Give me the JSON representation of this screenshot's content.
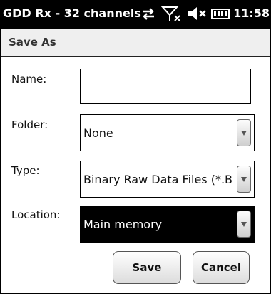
{
  "statusbar": {
    "title": "GDD Rx - 32 channels",
    "clock": "11:58",
    "icons": [
      "sync-arrows-icon",
      "no-signal-icon",
      "speaker-muted-icon",
      "battery-icon"
    ]
  },
  "dialog": {
    "title": "Save As"
  },
  "form": {
    "name_label": "Name:",
    "name_value": "",
    "folder_label": "Folder:",
    "folder_value": "None",
    "type_label": "Type:",
    "type_value": "Binary Raw Data Files (*.B",
    "location_label": "Location:",
    "location_value": "Main memory"
  },
  "buttons": {
    "save": "Save",
    "cancel": "Cancel"
  },
  "colors": {
    "statusbar_bg": "#000000",
    "header_bg": "#efefef",
    "selected_bg": "#000000"
  }
}
